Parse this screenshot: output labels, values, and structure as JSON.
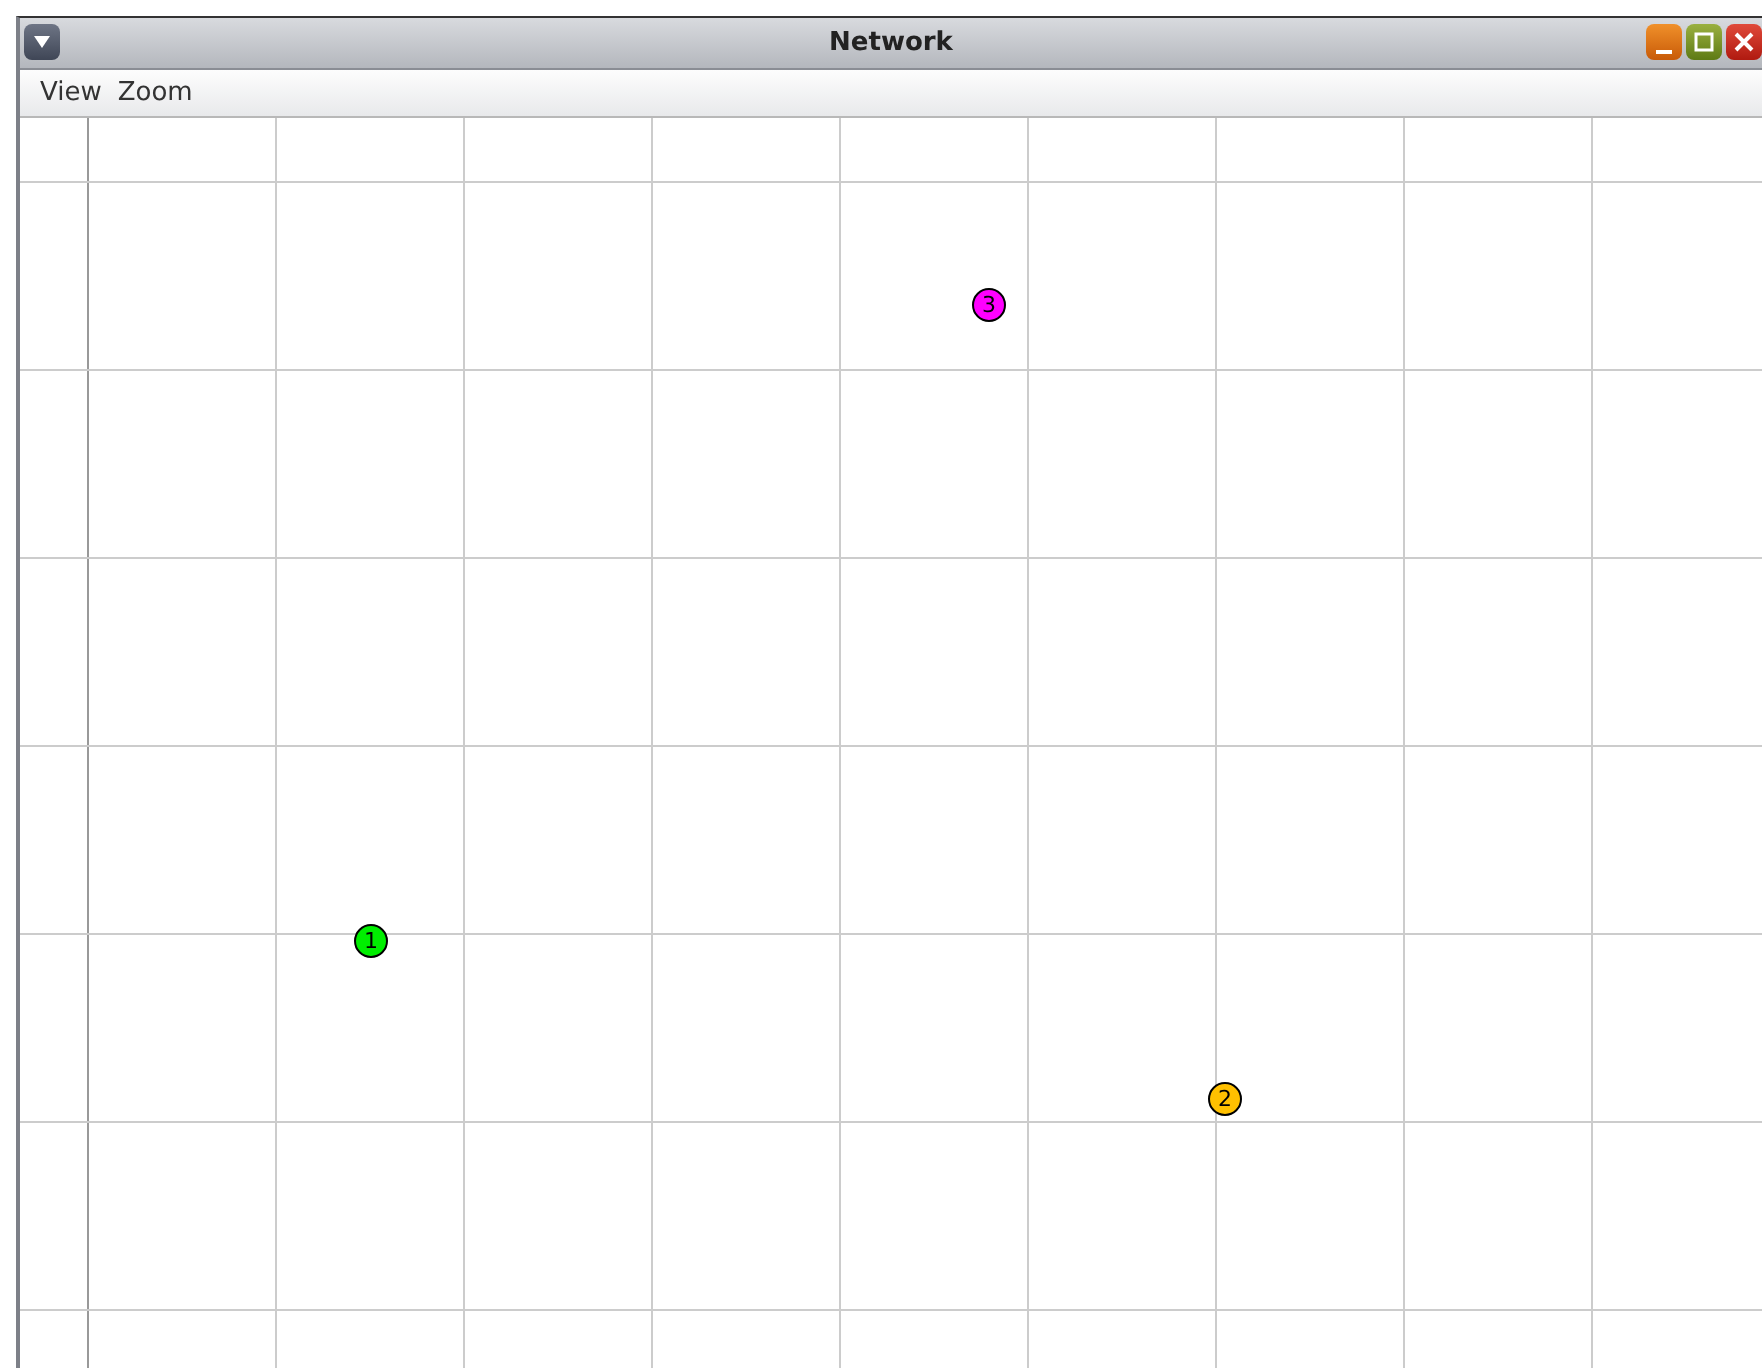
{
  "window": {
    "title": "Network"
  },
  "menu": [
    "View",
    "Zoom"
  ],
  "nodes": [
    {
      "label": "1",
      "color": "#00ee00"
    },
    {
      "label": "2",
      "color": "#ffc000"
    },
    {
      "label": "3",
      "color": "#ff00ff"
    }
  ]
}
